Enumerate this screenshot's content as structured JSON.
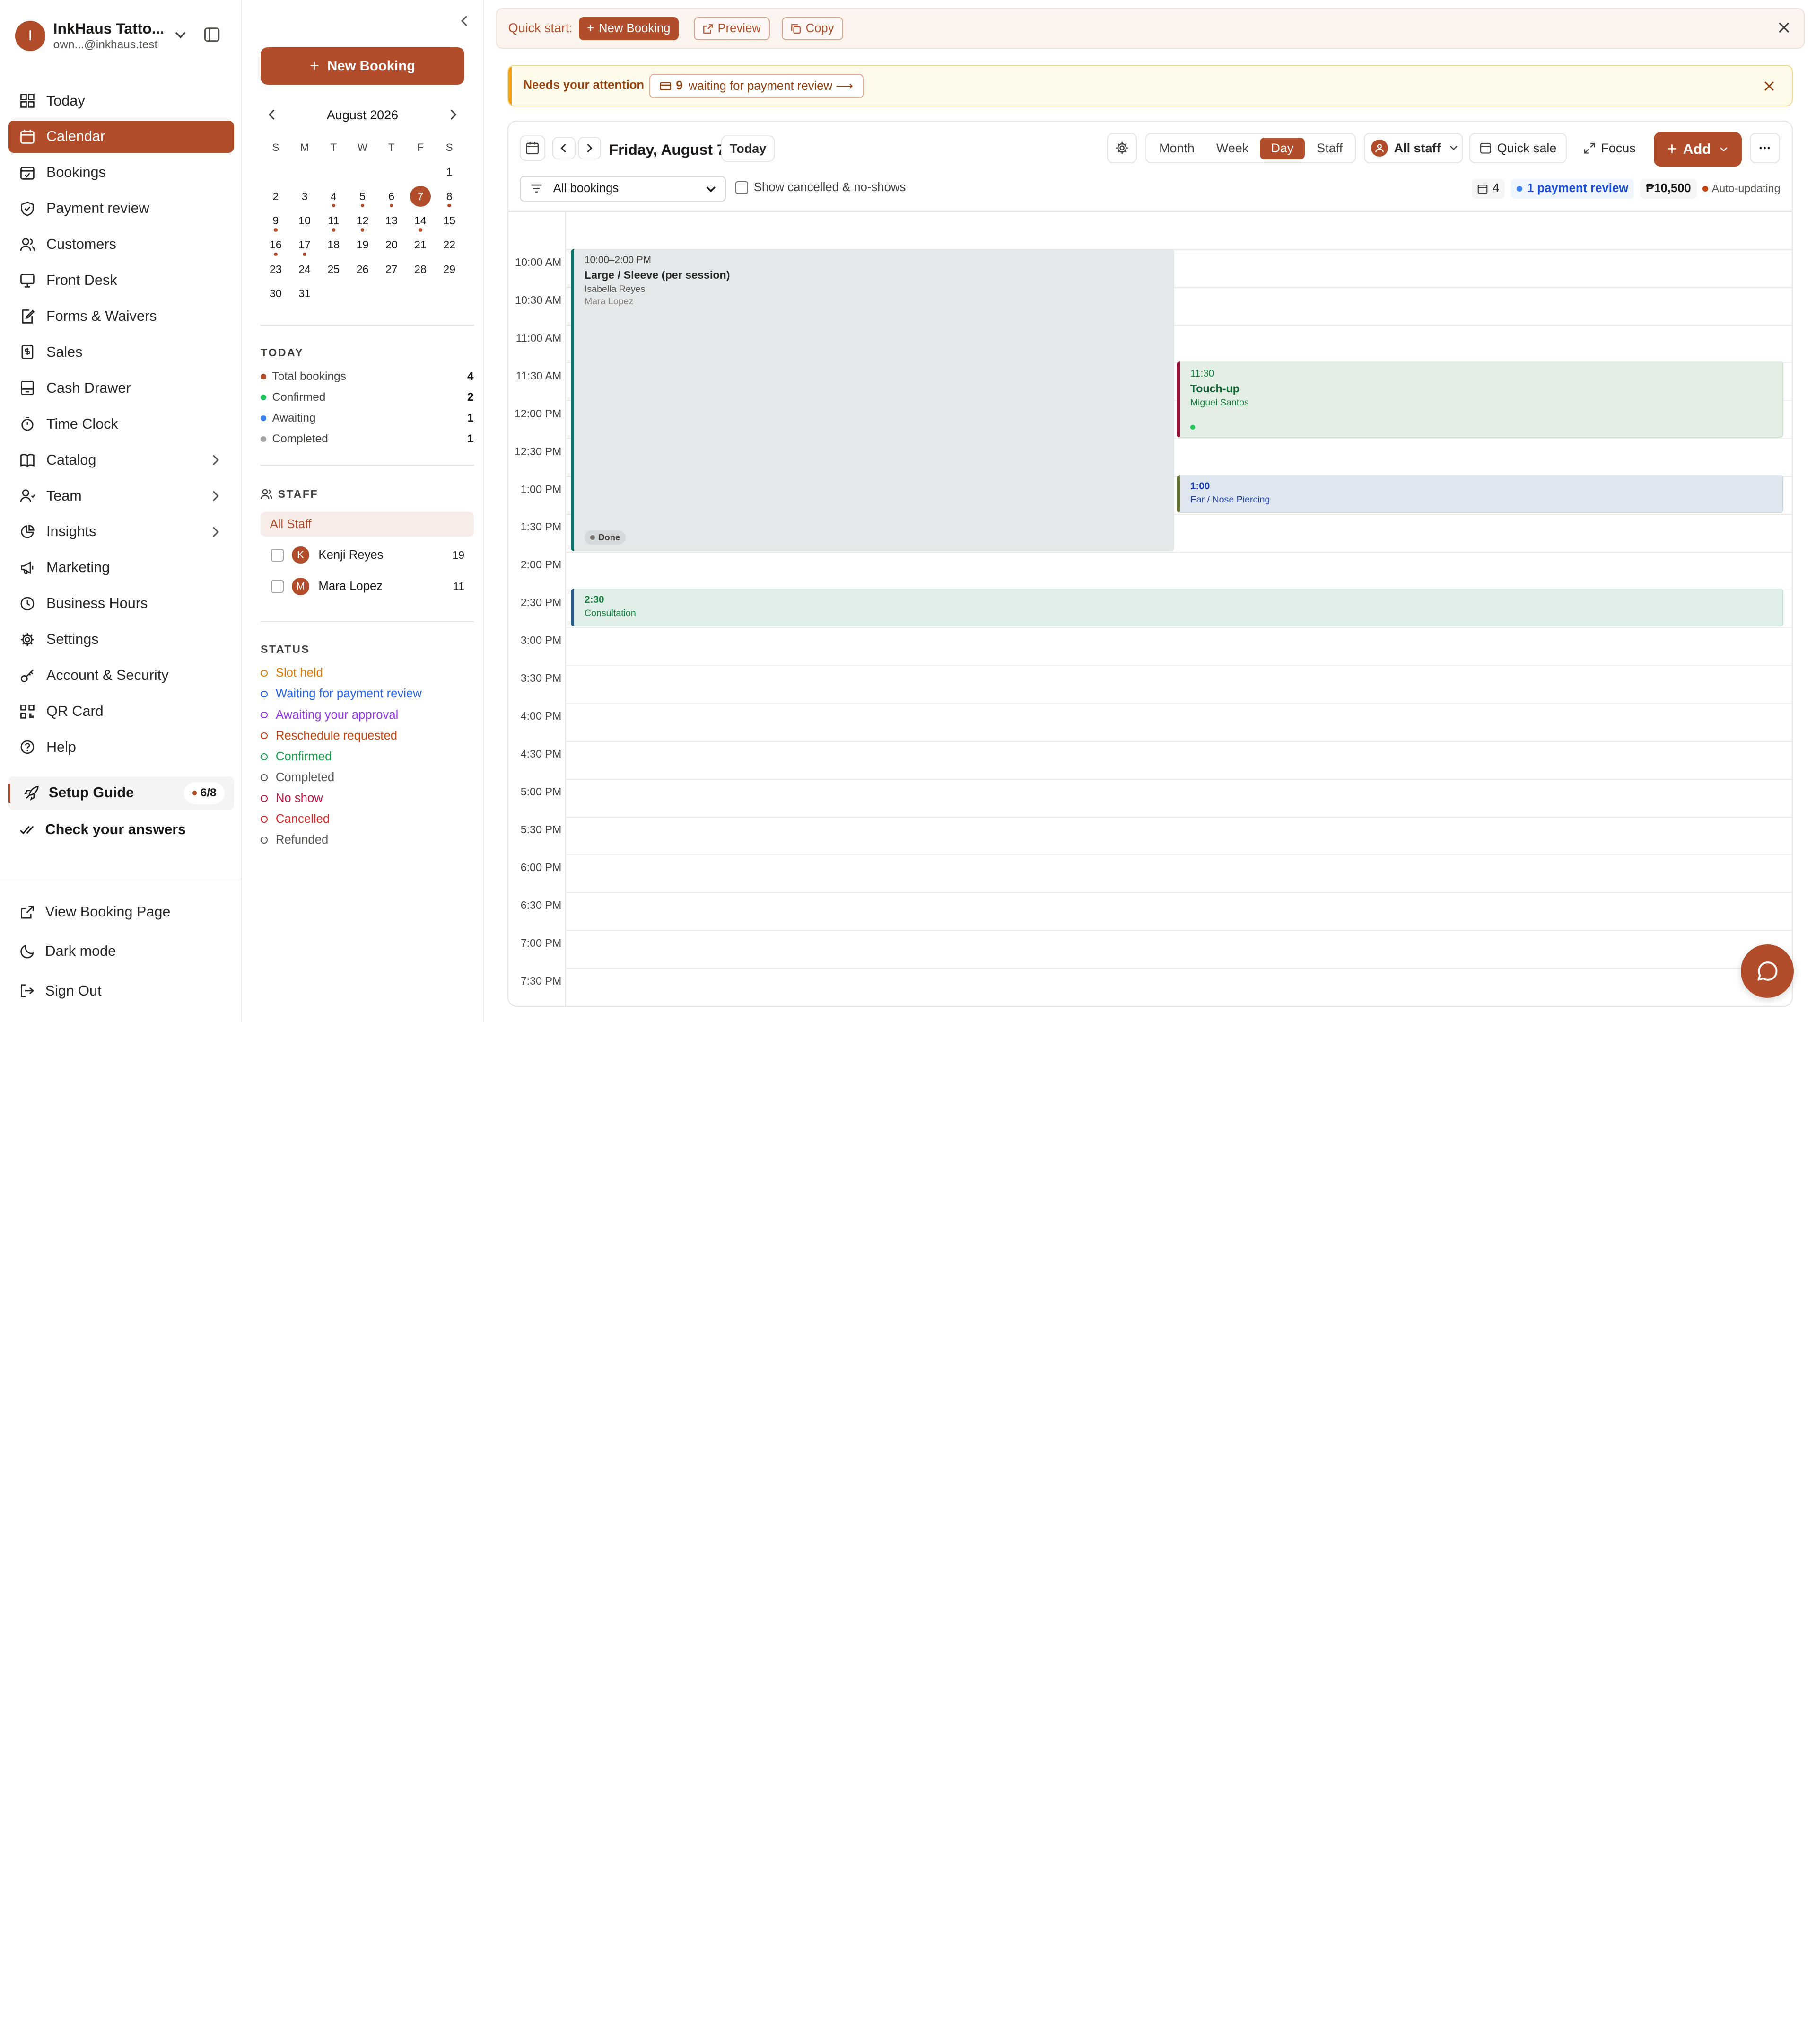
{
  "account": {
    "initial": "I",
    "name": "InkHaus Tatto...",
    "email": "own...@inkhaus.test"
  },
  "nav": {
    "items": [
      {
        "label": "Today",
        "icon": "grid-icon"
      },
      {
        "label": "Calendar",
        "icon": "calendar-icon",
        "active": true
      },
      {
        "label": "Bookings",
        "icon": "calendar-check-icon"
      },
      {
        "label": "Payment review",
        "icon": "shield-check-icon"
      },
      {
        "label": "Customers",
        "icon": "users-icon"
      },
      {
        "label": "Front Desk",
        "icon": "monitor-icon"
      },
      {
        "label": "Forms & Waivers",
        "icon": "file-edit-icon"
      },
      {
        "label": "Sales",
        "icon": "receipt-icon"
      },
      {
        "label": "Cash Drawer",
        "icon": "drawer-icon"
      },
      {
        "label": "Time Clock",
        "icon": "stopwatch-icon"
      },
      {
        "label": "Catalog",
        "icon": "book-icon",
        "has_children": true
      },
      {
        "label": "Team",
        "icon": "user-group-icon",
        "has_children": true
      },
      {
        "label": "Insights",
        "icon": "pie-chart-icon",
        "has_children": true
      },
      {
        "label": "Marketing",
        "icon": "megaphone-icon"
      },
      {
        "label": "Business Hours",
        "icon": "clock-icon"
      },
      {
        "label": "Settings",
        "icon": "gear-icon"
      },
      {
        "label": "Account & Security",
        "icon": "key-icon"
      },
      {
        "label": "QR Card",
        "icon": "qr-icon"
      },
      {
        "label": "Help",
        "icon": "help-icon"
      }
    ],
    "setup_guide": {
      "label": "Setup Guide",
      "progress": "6/8"
    },
    "check_answers": "Check your answers",
    "footer": {
      "view_booking_page": "View Booking Page",
      "dark_mode": "Dark mode",
      "sign_out": "Sign Out"
    }
  },
  "sidepanel": {
    "new_booking": "New Booking",
    "mini_calendar": {
      "month_label": "August 2026",
      "weekdays": [
        "S",
        "M",
        "T",
        "W",
        "T",
        "F",
        "S"
      ],
      "leading_blanks": 6,
      "days": [
        "1",
        "2",
        "3",
        "4",
        "5",
        "6",
        "7",
        "8",
        "9",
        "10",
        "11",
        "12",
        "13",
        "14",
        "15",
        "16",
        "17",
        "18",
        "19",
        "20",
        "21",
        "22",
        "23",
        "24",
        "25",
        "26",
        "27",
        "28",
        "29",
        "30",
        "31"
      ],
      "selected": "7",
      "days_with_bookings": [
        "4",
        "5",
        "6",
        "8",
        "9",
        "11",
        "12",
        "14",
        "16",
        "17"
      ]
    },
    "today": {
      "title": "TODAY",
      "rows": [
        {
          "label": "Total bookings",
          "value": "4",
          "color": "#b24d2b"
        },
        {
          "label": "Confirmed",
          "value": "2",
          "color": "#22c55e"
        },
        {
          "label": "Awaiting",
          "value": "1",
          "color": "#3b82f6"
        },
        {
          "label": "Completed",
          "value": "1",
          "color": "#a8a29e"
        }
      ]
    },
    "staff": {
      "title": "STAFF",
      "all_label": "All Staff",
      "members": [
        {
          "initial": "K",
          "name": "Kenji Reyes",
          "count": "19"
        },
        {
          "initial": "M",
          "name": "Mara Lopez",
          "count": "11"
        }
      ]
    },
    "status": {
      "title": "STATUS",
      "items": [
        {
          "label": "Slot held",
          "color": "#d97706"
        },
        {
          "label": "Waiting for payment review",
          "color": "#2563eb"
        },
        {
          "label": "Awaiting your approval",
          "color": "#9333ea"
        },
        {
          "label": "Reschedule requested",
          "color": "#c2410c"
        },
        {
          "label": "Confirmed",
          "color": "#16a34a"
        },
        {
          "label": "Completed",
          "color": "#57534e"
        },
        {
          "label": "No show",
          "color": "#be123c"
        },
        {
          "label": "Cancelled",
          "color": "#dc2626"
        },
        {
          "label": "Refunded",
          "color": "#57534e"
        }
      ]
    }
  },
  "quickstart": {
    "label": "Quick start:",
    "new_booking": "New Booking",
    "preview": "Preview",
    "copy": "Copy"
  },
  "attention": {
    "label": "Needs your attention",
    "count": "9",
    "chip_text": "waiting for payment review ⟶"
  },
  "calendar": {
    "title": "Friday, August 7",
    "today_button": "Today",
    "views": [
      "Month",
      "Week",
      "Day",
      "Staff"
    ],
    "active_view": "Day",
    "staff_filter": "All staff",
    "quick_sale": "Quick sale",
    "focus": "Focus",
    "add": "Add",
    "booking_filter": "All bookings",
    "show_cancelled": "Show cancelled & no-shows",
    "booking_count": "4",
    "payment_review": "1 payment review",
    "revenue": "₱10,500",
    "auto_updating": "Auto-updating",
    "time_slots": [
      "10:00 AM",
      "10:30 AM",
      "11:00 AM",
      "11:30 AM",
      "12:00 PM",
      "12:30 PM",
      "1:00 PM",
      "1:30 PM",
      "2:00 PM",
      "2:30 PM",
      "3:00 PM",
      "3:30 PM",
      "4:00 PM",
      "4:30 PM",
      "5:00 PM",
      "5:30 PM",
      "6:00 PM",
      "6:30 PM",
      "7:00 PM",
      "7:30 PM"
    ],
    "events": [
      {
        "time": "10:00–2:00 PM",
        "title": "Large / Sleeve (per session)",
        "customer": "Isabella Reyes",
        "staff": "Mara Lopez",
        "badge": "Done",
        "status_color": "#0f766e"
      },
      {
        "time": "11:30",
        "title": "Touch-up",
        "customer": "Miguel Santos",
        "status_color": "#9f1239"
      },
      {
        "time": "1:00",
        "title": "Ear / Nose Piercing",
        "status_color": "#6b7a3a"
      },
      {
        "time": "2:30",
        "title": "Consultation",
        "status_color": "#2f5d8a"
      }
    ]
  }
}
